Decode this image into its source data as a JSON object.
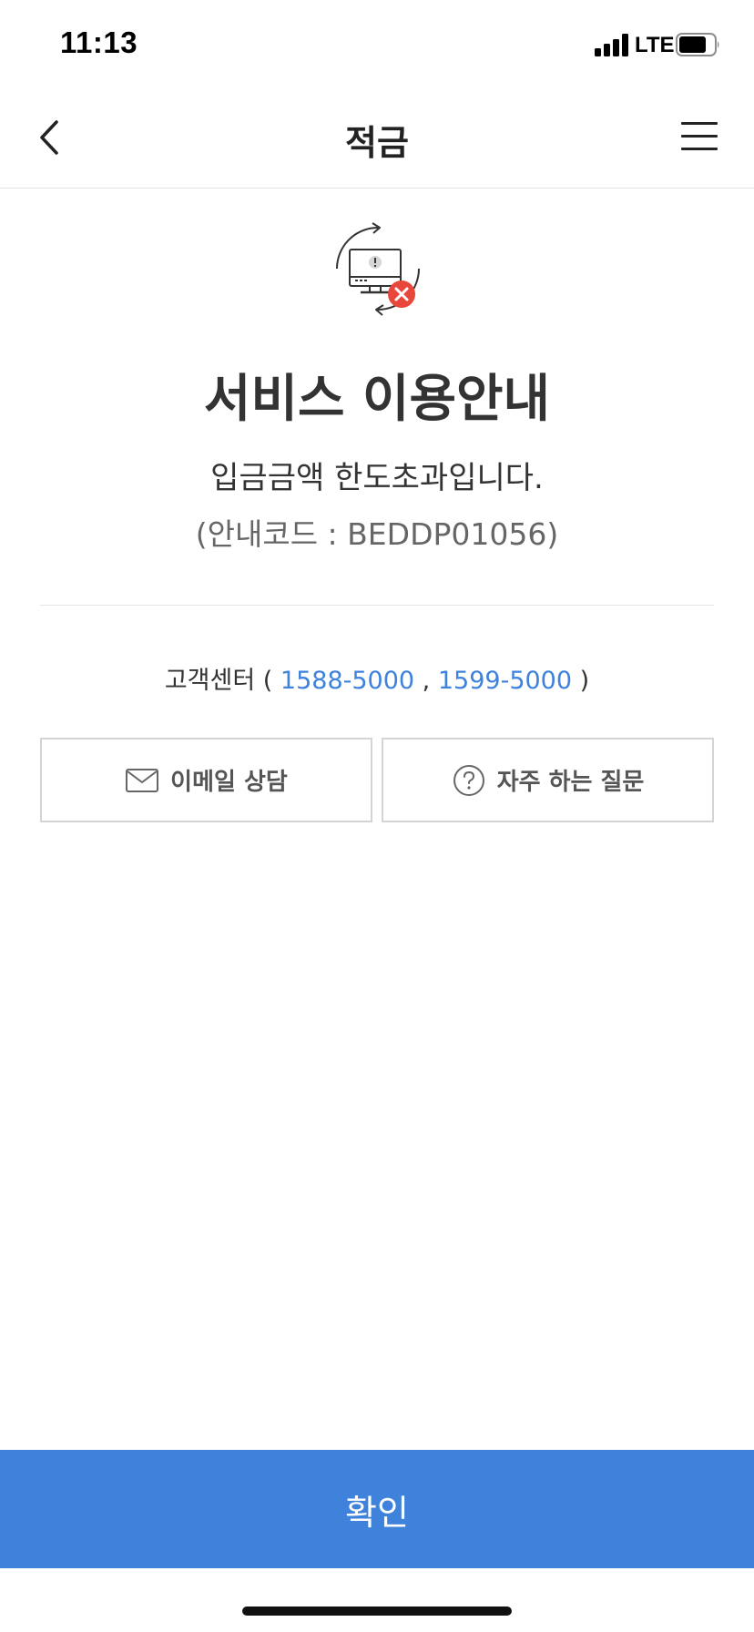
{
  "status_bar": {
    "time": "11:13",
    "network": "LTE"
  },
  "nav": {
    "title": "적금",
    "back_icon": "chevron-left-icon",
    "menu_icon": "hamburger-menu-icon"
  },
  "notice": {
    "icon": "monitor-error-icon",
    "headline": "서비스 이용안내",
    "message": "입금금액 한도초과입니다.",
    "code": "(안내코드 : BEDDP01056)"
  },
  "contact": {
    "label": "고객센터 (",
    "phone1": "1588-5000",
    "separator": ",",
    "phone2": "1599-5000",
    "close": ")"
  },
  "actions": {
    "email_label": "이메일 상담",
    "faq_label": "자주 하는 질문"
  },
  "footer": {
    "confirm_label": "확인"
  },
  "colors": {
    "accent": "#3e82dc",
    "error": "#e8473b"
  }
}
